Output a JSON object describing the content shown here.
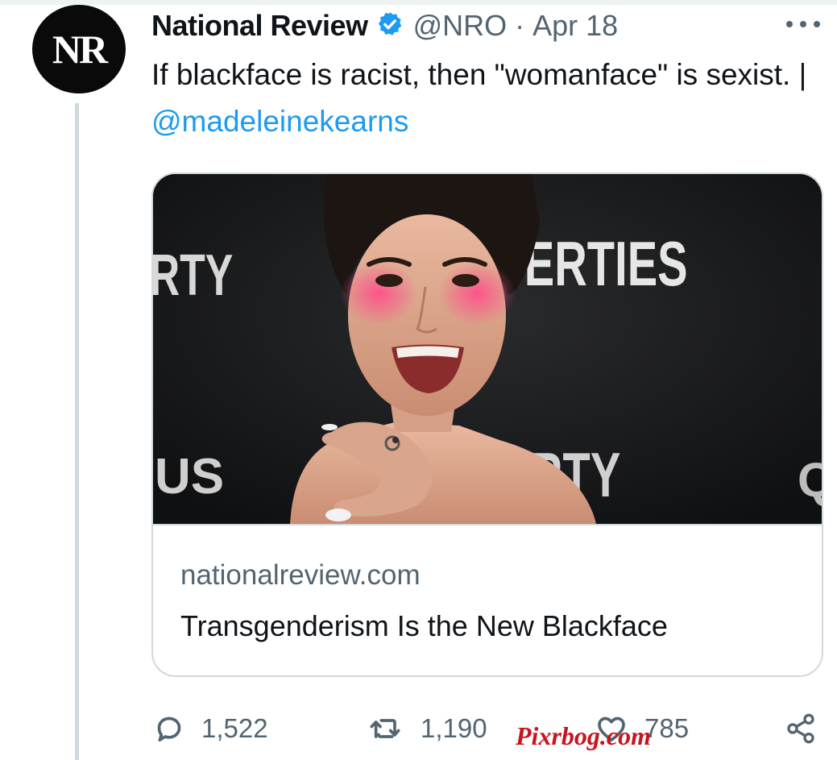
{
  "tweet": {
    "author_name": "National Review",
    "avatar_text": "NR",
    "handle": "@NRO",
    "separator": "·",
    "date": "Apr 18",
    "text_main": "If blackface is racist, then \"womanface\" is sexist. | ",
    "text_mention": "@madeleinekearns"
  },
  "card": {
    "domain": "nationalreview.com",
    "title": "Transgenderism Is the New Blackface",
    "image_backdrop_texts": [
      "RTY",
      "ERTIES",
      "US",
      "RTY",
      "Q"
    ]
  },
  "actions": {
    "reply_count": "1,522",
    "retweet_count": "1,190",
    "like_count": "785"
  },
  "icons": {
    "verified": "verified-badge-icon",
    "more": "more-options-icon",
    "reply": "reply-icon",
    "retweet": "retweet-icon",
    "like": "heart-icon",
    "share": "share-icon"
  },
  "colors": {
    "accent": "#1d9bf0",
    "secondary_text": "#536471",
    "border": "#cfd9de",
    "watermark": "#c8141e"
  },
  "watermark": "Pixrbog.com"
}
